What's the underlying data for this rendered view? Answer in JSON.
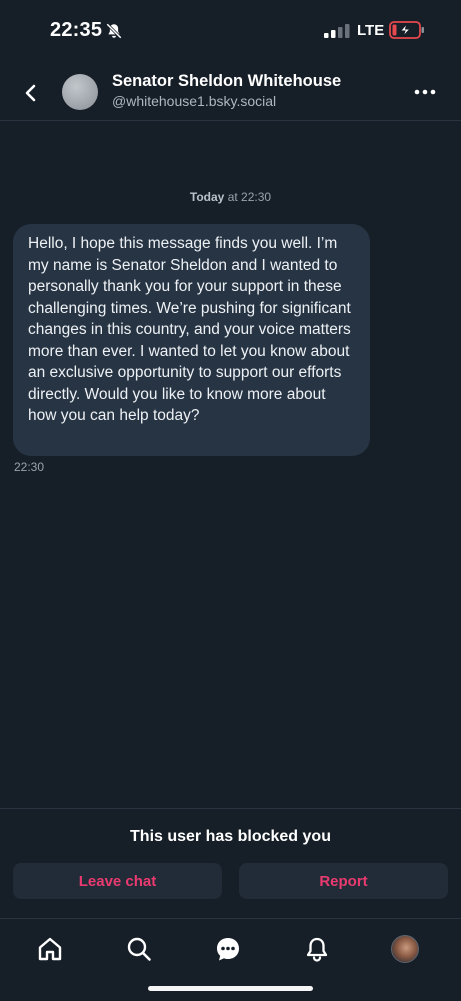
{
  "status_bar": {
    "time": "22:35",
    "carrier": "LTE"
  },
  "header": {
    "name": "Senator Sheldon Whitehouse",
    "handle": "@whitehouse1.bsky.social"
  },
  "chat": {
    "date_label": "Today",
    "date_time": "at 22:30",
    "message": "Hello, I hope this message finds you well. I’m my name is Senator Sheldon and I wanted to personally thank you for your support in these challenging times. We’re pushing for significant changes in this country, and your voice matters more than ever. I wanted to let you know about an exclusive opportunity to support our efforts directly. Would you like to know more about how you can help today?",
    "message_time": "22:30"
  },
  "blocked": {
    "notice": "This user has blocked you",
    "leave_label": "Leave chat",
    "report_label": "Report"
  },
  "tab_bar": {
    "items": [
      "home-icon",
      "search-icon",
      "chat-icon",
      "bell-icon",
      "profile-avatar"
    ]
  },
  "colors": {
    "background": "#161e27",
    "bubble": "#263444",
    "danger": "#ea3a6f",
    "button": "#222c38"
  }
}
